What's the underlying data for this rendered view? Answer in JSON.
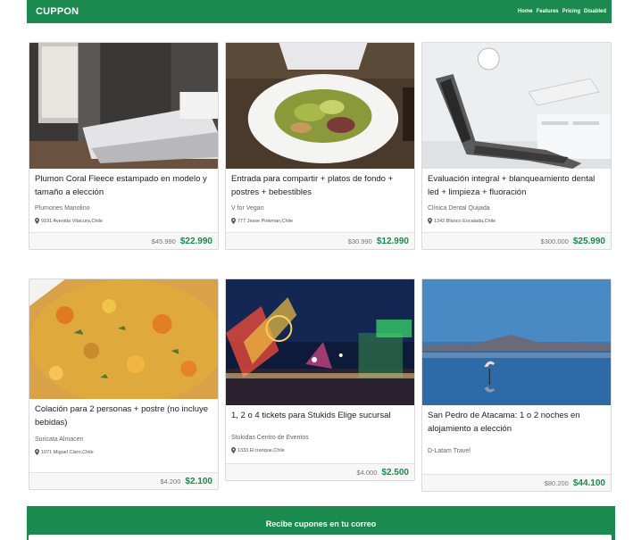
{
  "nav": {
    "brand": "CUPPON",
    "links": [
      "Home",
      "Features",
      "Pricing",
      "Disabled"
    ]
  },
  "deals": [
    {
      "image_icon": "bedroom-photo",
      "title": "Plumon Coral Fleece estampado en modelo y tamaño a elección",
      "vendor": "Plumones Manolino",
      "location": "9191 Avenida Vitacura,Chile",
      "old_price": "$45.990",
      "new_price": "$22.990"
    },
    {
      "image_icon": "salad-photo",
      "title": "Entrada para compartir + platos de fondo + postres + bebestibles",
      "vendor": "V for Vegan",
      "location": "777 Jesse Pinkman,Chile",
      "old_price": "$30.990",
      "new_price": "$12.990"
    },
    {
      "image_icon": "dental-chair-photo",
      "title": "Evaluación integral + blanqueamiento dental led + limpieza + fluoración",
      "vendor": "Clínica Dental Quijada",
      "location": "1342 Blanco Encalada,Chile",
      "old_price": "$300.000",
      "new_price": "$25.990"
    },
    {
      "image_icon": "curry-photo",
      "title": "Colación para 2 personas + postre (no incluye bebidas)",
      "vendor": "Suricata Almacen",
      "location": "1071 Miguel Claro,Chile",
      "old_price": "$4.200",
      "new_price": "$2.100"
    },
    {
      "image_icon": "amusement-park-photo",
      "title": "1, 2 o 4 tickets para Stukids Elige sucursal",
      "vendor": "Stukidas Centro de Eventos",
      "location": "1333 El tranque,Chile",
      "old_price": "$4.000",
      "new_price": "$2.500"
    },
    {
      "image_icon": "flamingo-lake-photo",
      "title": "San Pedro de Atacama: 1 o 2 noches en alojamiento a elección",
      "vendor": "D-Latam Travel",
      "location": "",
      "old_price": "$80.200",
      "new_price": "$44.100"
    }
  ],
  "newsletter": {
    "title": "Recibe cupones en tu correo"
  },
  "colors": {
    "brand_green": "#1a8a4e",
    "price_green": "#1a8a4e"
  }
}
